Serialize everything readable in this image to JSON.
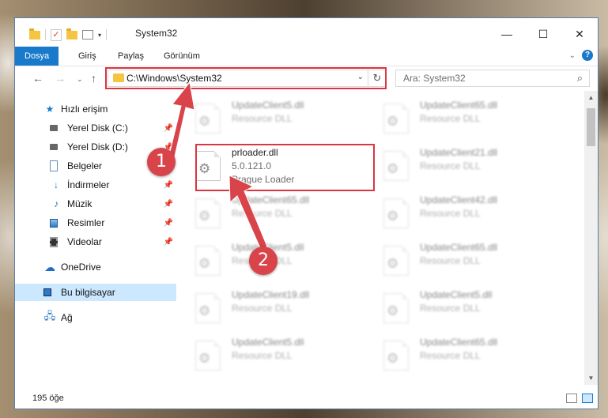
{
  "window": {
    "title": "System32"
  },
  "ribbon": {
    "tabs": [
      {
        "label": "Dosya",
        "active": true
      },
      {
        "label": "Giriş",
        "active": false
      },
      {
        "label": "Paylaş",
        "active": false
      },
      {
        "label": "Görünüm",
        "active": false
      }
    ]
  },
  "nav": {
    "address": "C:\\Windows\\System32",
    "search_placeholder": "Ara: System32"
  },
  "sidebar": {
    "items": [
      {
        "label": "Hızlı erişim",
        "icon": "star-icon",
        "pinned": false
      },
      {
        "label": "Yerel Disk (C:)",
        "icon": "drive-icon",
        "pinned": true
      },
      {
        "label": "Yerel Disk (D:)",
        "icon": "drive-icon",
        "pinned": true
      },
      {
        "label": "Belgeler",
        "icon": "documents-icon",
        "pinned": true
      },
      {
        "label": "İndirmeler",
        "icon": "downloads-icon",
        "pinned": true
      },
      {
        "label": "Müzik",
        "icon": "music-icon",
        "pinned": true
      },
      {
        "label": "Resimler",
        "icon": "pictures-icon",
        "pinned": true
      },
      {
        "label": "Videolar",
        "icon": "videos-icon",
        "pinned": true
      },
      {
        "label": "OneDrive",
        "icon": "onedrive-icon",
        "pinned": false
      },
      {
        "label": "Bu bilgisayar",
        "icon": "this-pc-icon",
        "pinned": false,
        "selected": true
      },
      {
        "label": "Ağ",
        "icon": "network-icon",
        "pinned": false
      }
    ]
  },
  "files": [
    {
      "name": "UpdateClient5.dll",
      "type": "Resource DLL"
    },
    {
      "name": "UpdateClient65.dll",
      "type": "Resource DLL"
    },
    {
      "name": "prloader.dll",
      "type": "5.0.121.0",
      "desc": "Prague Loader",
      "highlighted": true
    },
    {
      "name": "UpdateClient21.dll",
      "type": "Resource DLL"
    },
    {
      "name": "UpdateClient65.dll",
      "type": "Resource DLL"
    },
    {
      "name": "UpdateClient42.dll",
      "type": "Resource DLL"
    },
    {
      "name": "UpdateClient5.dll",
      "type": "Resource DLL"
    },
    {
      "name": "UpdateClient65.dll",
      "type": "Resource DLL"
    },
    {
      "name": "UpdateClient19.dll",
      "type": "Resource DLL"
    },
    {
      "name": "UpdateClient5.dll",
      "type": "Resource DLL"
    },
    {
      "name": "UpdateClient5.dll",
      "type": "Resource DLL"
    },
    {
      "name": "UpdateClient65.dll",
      "type": "Resource DLL"
    }
  ],
  "status": {
    "item_count": "195 öğe"
  },
  "annotations": {
    "step1": "1",
    "step2": "2"
  },
  "colors": {
    "accent": "#1979ca",
    "annotation_red": "#d9363e",
    "selected_bg": "#cce8ff"
  }
}
